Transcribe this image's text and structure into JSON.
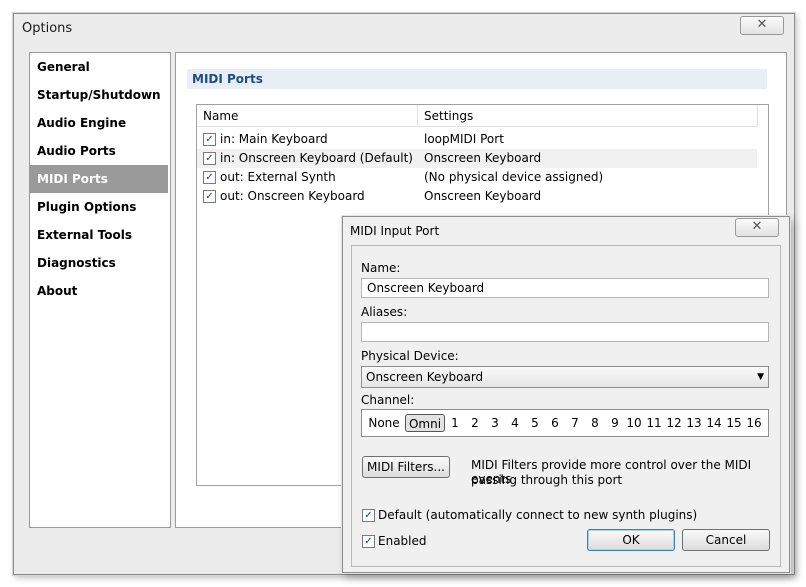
{
  "window": {
    "title": "Options",
    "close_glyph": "✕"
  },
  "sidebar": {
    "items": [
      {
        "label": "General"
      },
      {
        "label": "Startup/Shutdown"
      },
      {
        "label": "Audio Engine"
      },
      {
        "label": "Audio Ports"
      },
      {
        "label": "MIDI Ports",
        "selected": true
      },
      {
        "label": "Plugin Options"
      },
      {
        "label": "External Tools"
      },
      {
        "label": "Diagnostics"
      },
      {
        "label": "About"
      }
    ]
  },
  "content": {
    "section_title": "MIDI Ports",
    "table": {
      "headers": [
        "Name",
        "Settings"
      ],
      "rows": [
        {
          "name": "in: Main Keyboard",
          "settings": "loopMIDI Port",
          "checked": true
        },
        {
          "name": "in: Onscreen Keyboard (Default)",
          "settings": "Onscreen Keyboard",
          "checked": true
        },
        {
          "name": "out: External Synth",
          "settings": "(No physical device assigned)",
          "checked": true
        },
        {
          "name": "out: Onscreen Keyboard",
          "settings": "Onscreen Keyboard",
          "checked": true
        }
      ]
    }
  },
  "dialog": {
    "title": "MIDI Input Port",
    "close_glyph": "✕",
    "name_label": "Name:",
    "name_value": "Onscreen Keyboard",
    "aliases_label": "Aliases:",
    "aliases_value": "",
    "device_label": "Physical Device:",
    "device_value": "Onscreen Keyboard",
    "device_arrow": "▼",
    "channel_label": "Channel:",
    "channels": [
      "None",
      "Omni",
      "1",
      "2",
      "3",
      "4",
      "5",
      "6",
      "7",
      "8",
      "9",
      "10",
      "11",
      "12",
      "13",
      "14",
      "15",
      "16"
    ],
    "selected_channel": "Omni",
    "filters_button": "MIDI Filters...",
    "filters_desc_line1": "MIDI Filters provide more control over the MIDI events",
    "filters_desc_line2": "passing through this port",
    "default_label": "Default (automatically connect to new synth plugins)",
    "default_checked": true,
    "enabled_label": "Enabled",
    "enabled_checked": true,
    "ok_label": "OK",
    "cancel_label": "Cancel",
    "check_glyph": "✓"
  }
}
